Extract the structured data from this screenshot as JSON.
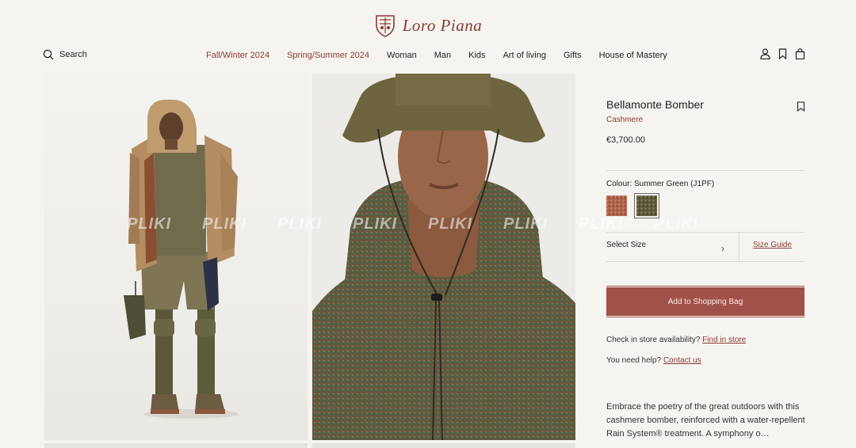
{
  "brand": {
    "logo_text": "Loro Piana"
  },
  "header": {
    "search_label": "Search",
    "nav": [
      "Fall/Winter 2024",
      "Spring/Summer 2024",
      "Woman",
      "Man",
      "Kids",
      "Art of living",
      "Gifts",
      "House of Mastery"
    ],
    "nav_accent": [
      true,
      true,
      false,
      false,
      false,
      false,
      false,
      false
    ],
    "icons": [
      "account-icon",
      "wishlist-icon",
      "shopping-bag-icon"
    ]
  },
  "gallery": {
    "watermark": "PLIKI"
  },
  "product": {
    "name": "Bellamonte Bomber",
    "material": "Cashmere",
    "price": "€3,700.00",
    "colour_label": "Colour: Summer Green (J1PF)",
    "swatches": [
      {
        "name": "rust",
        "color": "#b0664d",
        "selected": false
      },
      {
        "name": "summer-green",
        "color": "#5f5a3c",
        "selected": true
      }
    ],
    "select_size": "Select Size",
    "size_guide": "Size Guide",
    "add_to_bag": "Add to Shopping Bag",
    "store_prefix": "Check in store availability?",
    "store_link": "Find in store",
    "help_prefix": "You need help?",
    "help_link": "Contact us",
    "description": "Embrace the poetry of the great outdoors with this cashmere bomber, reinforced with a water-repellent Rain System® treatment. A symphony o…"
  },
  "colors": {
    "accent": "#8a3a33",
    "button": "#a0524a",
    "background": "#f6f4f0"
  }
}
